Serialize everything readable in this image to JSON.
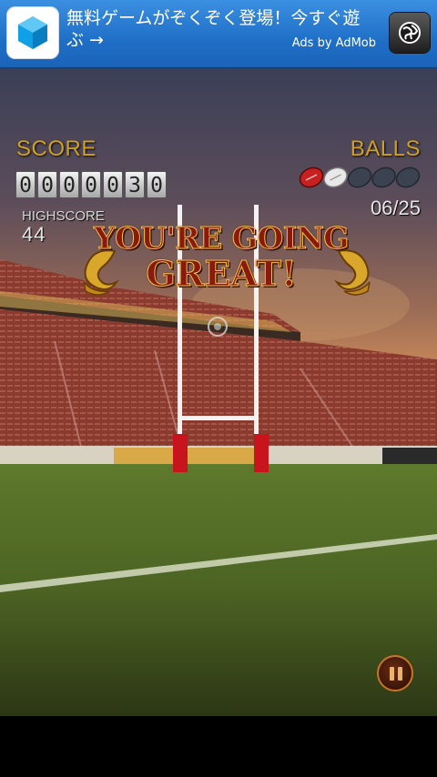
{
  "ad": {
    "text": "無料ゲームがぞくぞく登場！今すぐ遊ぶ →",
    "attribution": "Ads by AdMob",
    "icon": "hexagon-app-icon",
    "action_icon": "globe-icon"
  },
  "hud": {
    "score_label": "SCORE",
    "score_digits": [
      "0",
      "0",
      "0",
      "0",
      "0",
      "3",
      "0"
    ],
    "highscore_label": "HIGHSCORE",
    "highscore_value": "44",
    "balls_label": "BALLS",
    "balls_count": "06/25",
    "balls": {
      "shown": 5,
      "states": [
        "red",
        "white",
        "empty",
        "empty",
        "empty"
      ]
    }
  },
  "message": {
    "line1": "YOU'RE GOING",
    "line2": "GREAT!"
  },
  "controls": {
    "pause_icon": "pause-icon"
  },
  "colors": {
    "hud_gold": "#d2a021",
    "ad_blue": "#1f6fc7",
    "post_red": "#c8141c"
  }
}
